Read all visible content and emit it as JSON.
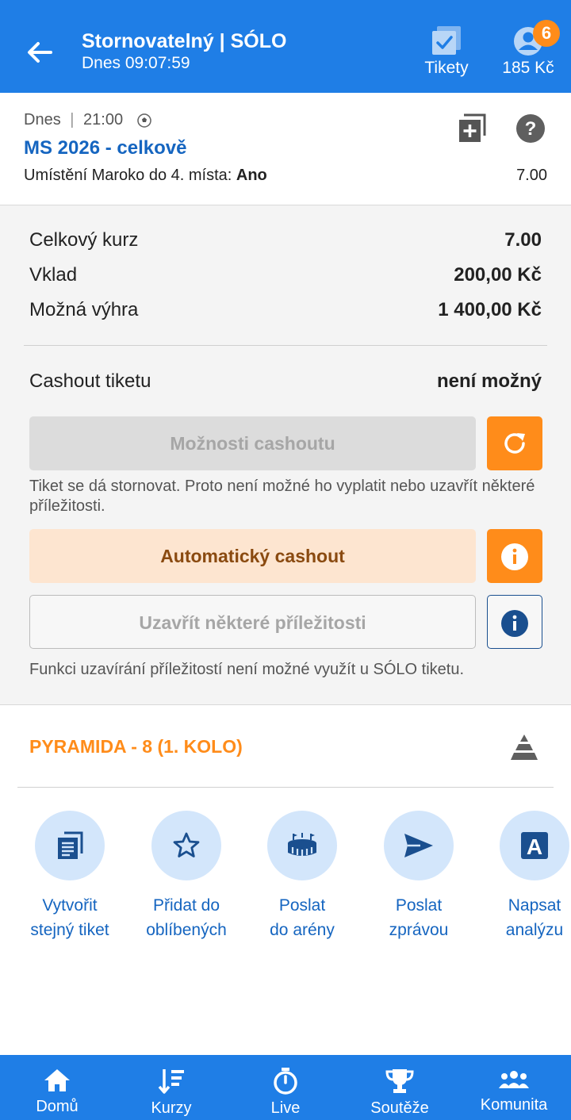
{
  "header": {
    "title": "Stornovatelný | SÓLO",
    "subtitle": "Dnes 09:07:59",
    "tickets_label": "Tikety",
    "balance": "185 Kč",
    "notification_count": "6"
  },
  "event": {
    "date": "Dnes",
    "time": "21:00",
    "name": "MS 2026 - celkově",
    "market": "Umístění Maroko do 4. místa:",
    "selection": "Ano",
    "odds": "7.00"
  },
  "summary": {
    "total_odds_label": "Celkový kurz",
    "total_odds_value": "7.00",
    "stake_label": "Vklad",
    "stake_value": "200,00 Kč",
    "win_label": "Možná výhra",
    "win_value": "1 400,00 Kč",
    "cashout_label": "Cashout tiketu",
    "cashout_value": "není možný",
    "cashout_options_button": "Možnosti cashoutu",
    "cashout_note": "Tiket se dá stornovat. Proto není možné ho vyplatit nebo uzavřít některé příležitosti.",
    "auto_cashout_button": "Automatický cashout",
    "close_opportunities_button": "Uzavřít některé příležitosti",
    "close_note": "Funkci uzavírání příležitostí není možné využít u SÓLO tiketu."
  },
  "pyramida": {
    "title": "PYRAMIDA - 8 (1. KOLO)"
  },
  "actions": [
    {
      "line1": "Vytvořit",
      "line2": "stejný tiket"
    },
    {
      "line1": "Přidat do",
      "line2": "oblíbených"
    },
    {
      "line1": "Poslat",
      "line2": "do arény"
    },
    {
      "line1": "Poslat",
      "line2": "zprávou"
    },
    {
      "line1": "Napsat",
      "line2": "analýzu"
    }
  ],
  "bottom_nav": [
    {
      "label": "Domů"
    },
    {
      "label": "Kurzy"
    },
    {
      "label": "Live"
    },
    {
      "label": "Soutěže"
    },
    {
      "label": "Komunita"
    }
  ],
  "colors": {
    "primary": "#1f7ee6",
    "accent": "#ff8c1a",
    "link": "#1565c0"
  }
}
